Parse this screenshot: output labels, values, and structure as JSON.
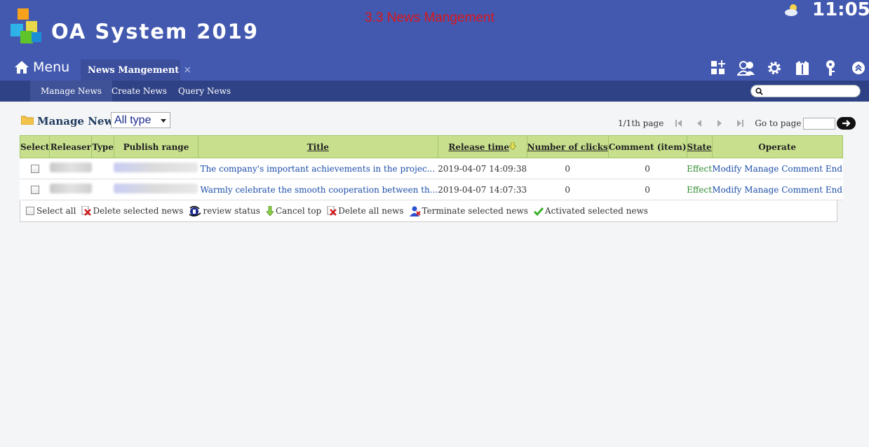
{
  "app": {
    "title": "OA System 2019",
    "annotation": "3.3 News Mangement",
    "clock": "11:05"
  },
  "nav": {
    "menu_label": "Menu",
    "active_tab": "News Mangement",
    "tab_close": "×",
    "toolbar_icons": [
      "apps-add-icon",
      "users-icon",
      "gear-icon",
      "shirt-icon",
      "key-icon",
      "collapse-up-icon"
    ]
  },
  "subnav": {
    "items": [
      "Manage News",
      "Create News",
      "Query News"
    ],
    "active": "Manage News",
    "search_placeholder": ""
  },
  "page": {
    "title": "Manage News",
    "type_filter": "All type"
  },
  "pager": {
    "page_info": "1/1th page",
    "goto_label": "Go to page",
    "goto_value": ""
  },
  "table": {
    "headers": {
      "select": "Select",
      "releaser": "Releaser",
      "type": "Type",
      "publish_range": "Publish range",
      "title": "Title",
      "release_time": "Release time",
      "clicks": "Number of clicks",
      "comments": "Comment (item)",
      "state": "State",
      "operate": "Operate"
    },
    "rows": [
      {
        "title": "The company's important achievements in the projec...",
        "release_time": "2019-04-07 14:09:38",
        "clicks": "0",
        "comments": "0",
        "state": "Effect",
        "ops": [
          "Modify",
          "Manage",
          "Comment",
          "End"
        ]
      },
      {
        "title": "Warmly celebrate the smooth cooperation between th...",
        "release_time": "2019-04-07 14:07:33",
        "clicks": "0",
        "comments": "0",
        "state": "Effect",
        "ops": [
          "Modify",
          "Manage",
          "Comment",
          "End"
        ]
      }
    ]
  },
  "actions": {
    "select_all": "Select all",
    "delete_selected": "Delete selected news",
    "review_status": "review status",
    "cancel_top": "Cancel top",
    "delete_all": "Delete all news",
    "terminate_selected": "Terminate selected news",
    "activate_selected": "Activated selected news"
  },
  "colors": {
    "header_bg": "#4359b0",
    "subnav_bg": "#2f4286",
    "table_header_bg": "#c8e08e",
    "link": "#1d4ea8",
    "state_green": "#2d8a2d",
    "annotation_red": "#d8161a"
  }
}
